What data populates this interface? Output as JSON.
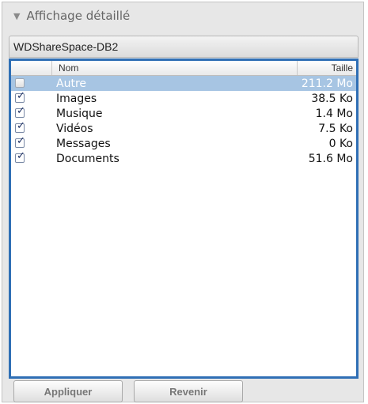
{
  "section": {
    "title": "Affichage détaillé"
  },
  "device": {
    "name": "WDShareSpace-DB2"
  },
  "table": {
    "col_name": "Nom",
    "col_size": "Taille",
    "rows": [
      {
        "name": "Autre",
        "size": "211.2 Mo",
        "checked": false,
        "selected": true
      },
      {
        "name": "Images",
        "size": "38.5 Ko",
        "checked": true,
        "selected": false
      },
      {
        "name": "Musique",
        "size": "1.4 Mo",
        "checked": true,
        "selected": false
      },
      {
        "name": "Vidéos",
        "size": "7.5 Ko",
        "checked": true,
        "selected": false
      },
      {
        "name": "Messages",
        "size": "0 Ko",
        "checked": true,
        "selected": false
      },
      {
        "name": "Documents",
        "size": "51.6 Mo",
        "checked": true,
        "selected": false
      }
    ]
  },
  "buttons": {
    "apply": "Appliquer",
    "revert": "Revenir"
  },
  "colors": {
    "selection": "#a7c5e3",
    "focus_ring": "#2f6fb5"
  }
}
